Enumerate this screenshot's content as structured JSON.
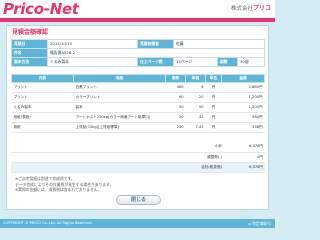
{
  "header": {
    "logo": "Prico-Net",
    "company_prefix": "株式会社",
    "company_name": "プリコ"
  },
  "page_title": "見積金額確認",
  "info": {
    "rows": [
      {
        "label1": "見積日",
        "value1": "2015/10/15",
        "label2": "見積依頼者",
        "value2": "佐藤"
      },
      {
        "label1": "件名",
        "value1": "報告書A526-2",
        "label2": "",
        "value2": ""
      },
      {
        "label1": "製本方法",
        "value1": "くるみ製本",
        "label2": "仕上ページ数",
        "value2": "15ページ",
        "label3": "部数",
        "value3": "30部"
      }
    ]
  },
  "items": {
    "headers": [
      "内容",
      "用紙",
      "面数",
      "単価",
      "単位",
      "金額"
    ],
    "rows": [
      {
        "content": "プリント",
        "paper": "白黒プリント",
        "faces": "480",
        "price": "6",
        "unit": "円",
        "amount": "2,880円"
      },
      {
        "content": "プリント",
        "paper": "カラープリント",
        "faces": "60",
        "price": "20",
        "unit": "円",
        "amount": "1,200円"
      },
      {
        "content": "くるみ製本",
        "paper": "製本",
        "faces": "30",
        "price": "50",
        "unit": "円",
        "amount": "1,500円"
      },
      {
        "content": "用紙(表紙)",
        "paper": "アートポスト250kg[カラー両面アート紙厚口]",
        "faces": "30",
        "price": "32",
        "unit": "円",
        "amount": "960円"
      },
      {
        "content": "用紙",
        "paper": "上質紙(70kg)[上質紙標準]",
        "faces": "240",
        "price": "7.45",
        "unit": "円",
        "amount": "336円"
      }
    ]
  },
  "totals": {
    "rows": [
      {
        "label": "小計",
        "value": "6,376円"
      },
      {
        "label": "調整費(-)",
        "value": "0円"
      },
      {
        "label": "合計(税抜価)",
        "value": "6,376円"
      }
    ]
  },
  "notes": {
    "line1": "※ご自宅用紙は別途で作成費です。",
    "line2": "データ作成によりその作業費が発生する場合があります。",
    "line3": "※実際の金額には、消費税は含まれておりません。"
  },
  "buttons": {
    "close": "閉じる"
  },
  "footer": {
    "copyright": "COPYRIGHT © PRICO Co.,Ltd. All Rights Reserved",
    "tokusho": "特定商取引"
  },
  "colors": {
    "brand_pink": "#e8346a",
    "header_blue": "#5fb5d9",
    "background": "#d6ecf3"
  }
}
